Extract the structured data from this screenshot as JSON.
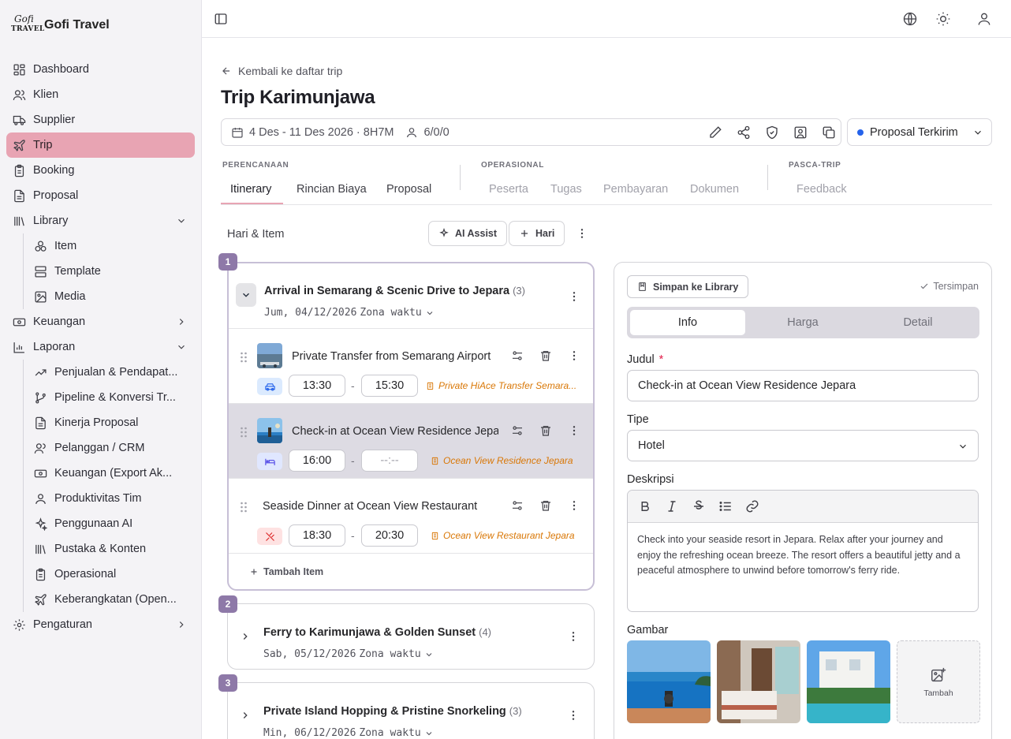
{
  "app": {
    "name": "Gofi Travel",
    "logo_top": "Gofi",
    "logo_bottom": "TRAVEL"
  },
  "sidebar": {
    "items": [
      {
        "label": "Dashboard",
        "icon": "dashboard-icon"
      },
      {
        "label": "Klien",
        "icon": "users-icon"
      },
      {
        "label": "Supplier",
        "icon": "truck-icon"
      },
      {
        "label": "Trip",
        "icon": "plane-icon",
        "active": true
      },
      {
        "label": "Booking",
        "icon": "clipboard-icon"
      },
      {
        "label": "Proposal",
        "icon": "file-icon"
      },
      {
        "label": "Library",
        "icon": "library-icon",
        "expanded": true
      },
      {
        "label": "Keuangan",
        "icon": "banknote-icon"
      },
      {
        "label": "Laporan",
        "icon": "chart-icon",
        "expanded": true
      },
      {
        "label": "Pengaturan",
        "icon": "gear-icon"
      }
    ],
    "library_sub": [
      {
        "label": "Item",
        "icon": "boxes-icon"
      },
      {
        "label": "Template",
        "icon": "layout-icon"
      },
      {
        "label": "Media",
        "icon": "image-icon"
      }
    ],
    "laporan_sub": [
      {
        "label": "Penjualan & Pendapat...",
        "icon": "trending-up-icon"
      },
      {
        "label": "Pipeline & Konversi Tr...",
        "icon": "git-branch-icon"
      },
      {
        "label": "Kinerja Proposal",
        "icon": "file-text-icon"
      },
      {
        "label": "Pelanggan / CRM",
        "icon": "users-icon"
      },
      {
        "label": "Keuangan (Export Ak...",
        "icon": "banknote-icon"
      },
      {
        "label": "Produktivitas Tim",
        "icon": "user-icon"
      },
      {
        "label": "Penggunaan AI",
        "icon": "sparkles-icon"
      },
      {
        "label": "Pustaka & Konten",
        "icon": "library-icon"
      },
      {
        "label": "Operasional",
        "icon": "clipboard-icon"
      },
      {
        "label": "Keberangkatan (Open...",
        "icon": "plane-icon"
      }
    ]
  },
  "page": {
    "back_label": "Kembali ke daftar trip",
    "title": "Trip Karimunjawa",
    "dates": "4 Des - 11 Des 2026",
    "duration": "· 8H7M",
    "pax": "6/0/0",
    "status": "Proposal Terkirim",
    "status_color": "#2563eb"
  },
  "tabs": {
    "groups": [
      "PERENCANAAN",
      "OPERASIONAL",
      "PASCA-TRIP"
    ],
    "planning": [
      "Itinerary",
      "Rincian Biaya",
      "Proposal"
    ],
    "operational": [
      "Peserta",
      "Tugas",
      "Pembayaran",
      "Dokumen"
    ],
    "post": [
      "Feedback"
    ],
    "active": "Itinerary",
    "accent": "#e8a4b3"
  },
  "itinerary": {
    "heading": "Hari & Item",
    "ai_assist_label": "AI Assist",
    "add_day_label": "Hari",
    "add_item_label": "Tambah Item",
    "tz_label": "Zona waktu",
    "days": [
      {
        "num": "1",
        "title": "Arrival in Semarang & Scenic Drive to Jepara",
        "count": "(3)",
        "date": "Jum, 04/12/2026"
      },
      {
        "num": "2",
        "title": "Ferry to Karimunjawa & Golden Sunset",
        "count": "(4)",
        "date": "Sab, 05/12/2026"
      },
      {
        "num": "3",
        "title": "Private Island Hopping & Pristine Snorkeling",
        "count": "(3)",
        "date": "Min, 06/12/2026"
      }
    ],
    "items": [
      {
        "name": "Private Transfer from Semarang Airport",
        "start": "13:30",
        "end": "15:30",
        "supplier": "Private HiAce Transfer Semara...",
        "category": "car-icon"
      },
      {
        "name": "Check-in at Ocean View Residence Jepa",
        "start": "16:00",
        "end": "--:--",
        "supplier": "Ocean View Residence Jepara",
        "category": "bed-icon"
      },
      {
        "name": "Seaside Dinner at Ocean View Restaurant",
        "start": "18:30",
        "end": "20:30",
        "supplier": "Ocean View Restaurant Jepara",
        "category": "utensils-icon"
      }
    ]
  },
  "detail": {
    "save_library_label": "Simpan ke Library",
    "saved_label": "Tersimpan",
    "tabs": [
      "Info",
      "Harga",
      "Detail"
    ],
    "title_label": "Judul",
    "title_required": "*",
    "title_value": "Check-in at Ocean View Residence Jepara",
    "type_label": "Tipe",
    "type_value": "Hotel",
    "desc_label": "Deskripsi",
    "desc_value": "Check into your seaside resort in Jepara. Relax after your journey and enjoy the refreshing ocean breeze. The resort offers a beautiful jetty and a peaceful atmosphere to unwind before tomorrow's ferry ride.",
    "gallery_label": "Gambar",
    "gallery_add_label": "Tambah"
  }
}
